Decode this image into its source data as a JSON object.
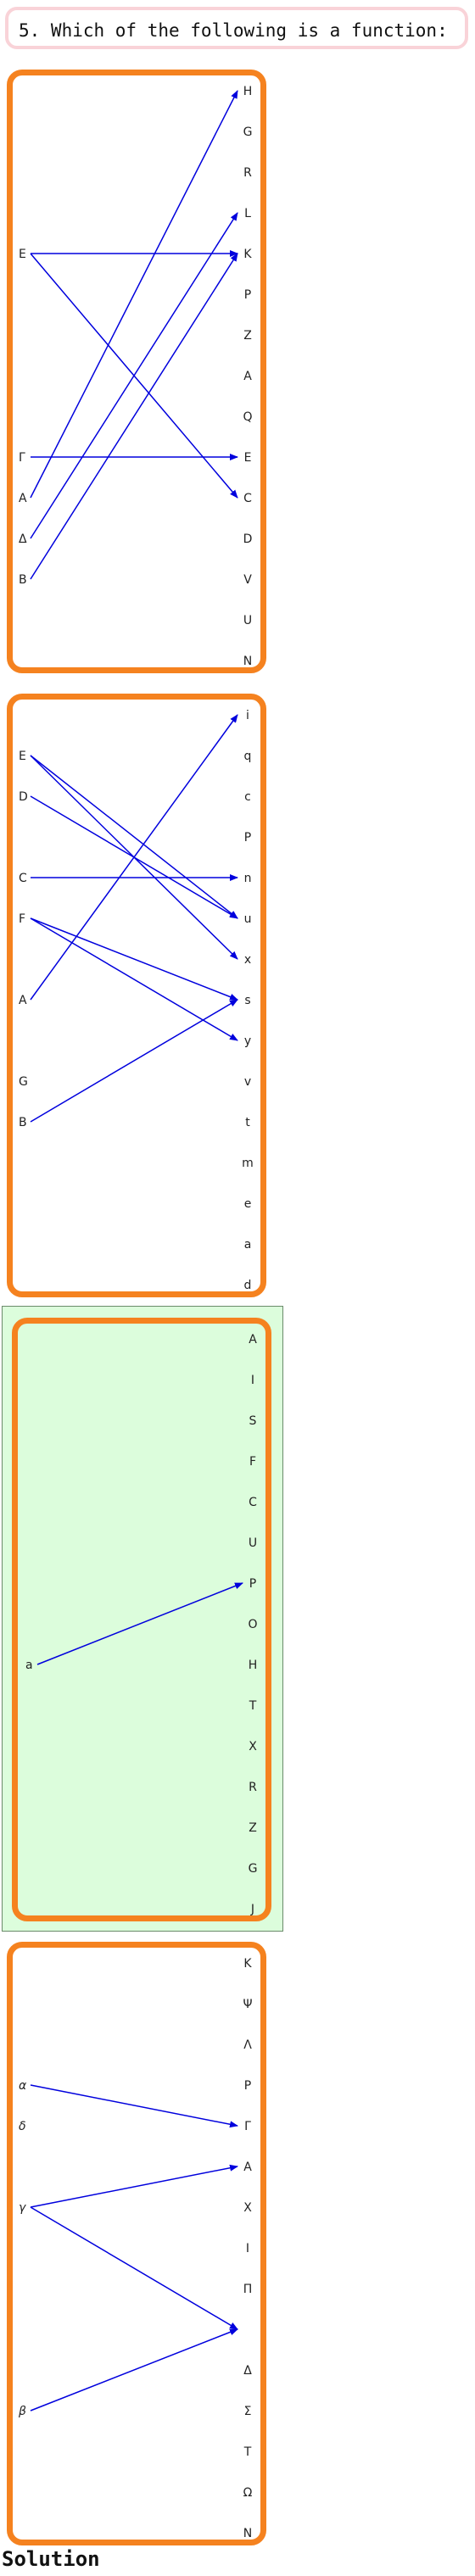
{
  "question": {
    "text": "5. Which of the following is a function:"
  },
  "solution_label": "Solution",
  "arrow_color": "#0000dd",
  "card_border_color": "#f5821f",
  "selected_background": "#dcfddc",
  "options": [
    {
      "id": "option-1",
      "selected": false,
      "domain": [
        "E",
        "Γ",
        "A",
        "Δ",
        "B"
      ],
      "codomain": [
        "H",
        "G",
        "R",
        "L",
        "K",
        "P",
        "Z",
        "A",
        "Q",
        "E",
        "C",
        "D",
        "V",
        "U",
        "N"
      ],
      "mappings": [
        {
          "from": "E",
          "to": "K"
        },
        {
          "from": "E",
          "to": "C"
        },
        {
          "from": "Γ",
          "to": "E"
        },
        {
          "from": "A",
          "to": "H"
        },
        {
          "from": "Δ",
          "to": "L"
        },
        {
          "from": "B",
          "to": "K"
        }
      ]
    },
    {
      "id": "option-2",
      "selected": false,
      "domain": [
        "E",
        "D",
        "C",
        "F",
        "A",
        "G",
        "B"
      ],
      "codomain": [
        "i",
        "q",
        "c",
        "P",
        "n",
        "u",
        "x",
        "s",
        "y",
        "v",
        "t",
        "m",
        "e",
        "a",
        "d"
      ],
      "mappings": [
        {
          "from": "E",
          "to": "u"
        },
        {
          "from": "E",
          "to": "x"
        },
        {
          "from": "D",
          "to": "u"
        },
        {
          "from": "C",
          "to": "n"
        },
        {
          "from": "F",
          "to": "s"
        },
        {
          "from": "F",
          "to": "y"
        },
        {
          "from": "A",
          "to": "i"
        },
        {
          "from": "B",
          "to": "s"
        }
      ]
    },
    {
      "id": "option-3",
      "selected": true,
      "domain": [
        "a"
      ],
      "codomain": [
        "A",
        "I",
        "S",
        "F",
        "C",
        "U",
        "P",
        "O",
        "H",
        "T",
        "X",
        "R",
        "Z",
        "G",
        "J"
      ],
      "mappings": [
        {
          "from": "a",
          "to": "P"
        }
      ]
    },
    {
      "id": "option-4",
      "selected": false,
      "domain": [
        "α",
        "δ",
        "γ",
        "β"
      ],
      "codomain": [
        "K",
        "Ψ",
        "Λ",
        "P",
        "Γ",
        "A",
        "X",
        "I",
        "Π",
        "",
        "Δ",
        "Σ",
        "T",
        "Ω",
        "N"
      ],
      "mappings": [
        {
          "from": "α",
          "to": "Γ"
        },
        {
          "from": "γ",
          "to": "A"
        },
        {
          "from": "γ",
          "to": ""
        },
        {
          "from": "β",
          "to": ""
        }
      ]
    }
  ]
}
